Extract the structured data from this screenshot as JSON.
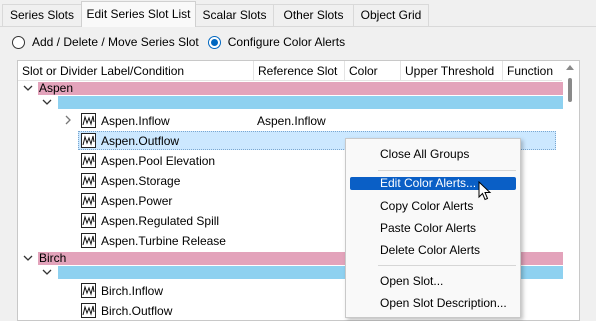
{
  "tabs": [
    {
      "label": "Series Slots"
    },
    {
      "label": "Edit Series Slot List"
    },
    {
      "label": "Scalar Slots"
    },
    {
      "label": "Other Slots"
    },
    {
      "label": "Object Grid"
    }
  ],
  "active_tab": "Edit Series Slot List",
  "modes": [
    {
      "label": "Add / Delete / Move Series Slot",
      "selected": false
    },
    {
      "label": "Configure Color Alerts",
      "selected": true
    }
  ],
  "grid": {
    "columns": [
      "Slot or Divider Label/Condition",
      "Reference Slot",
      "Color",
      "Upper Threshold",
      "Function"
    ],
    "groups": [
      {
        "label": "Aspen",
        "color_group": "#e3a3bb",
        "color_sub": "#8ed1f0",
        "slots": [
          {
            "label": "Aspen.Inflow",
            "reference": "Aspen.Inflow",
            "expandable": true
          },
          {
            "label": "Aspen.Outflow",
            "reference": "",
            "selected": true
          },
          {
            "label": "Aspen.Pool Elevation",
            "reference": ""
          },
          {
            "label": "Aspen.Storage",
            "reference": ""
          },
          {
            "label": "Aspen.Power",
            "reference": ""
          },
          {
            "label": "Aspen.Regulated Spill",
            "reference": ""
          },
          {
            "label": "Aspen.Turbine Release",
            "reference": ""
          }
        ]
      },
      {
        "label": "Birch",
        "color_group": "#e3a3bb",
        "color_sub": "#8ed1f0",
        "slots": [
          {
            "label": "Birch.Inflow",
            "reference": ""
          },
          {
            "label": "Birch.Outflow",
            "reference": ""
          }
        ]
      }
    ]
  },
  "context_menu": {
    "items": [
      {
        "label": "Close All Groups"
      },
      {
        "label": "Edit Color Alerts...",
        "highlighted": true
      },
      {
        "label": "Copy Color Alerts"
      },
      {
        "label": "Paste Color Alerts"
      },
      {
        "label": "Delete Color Alerts"
      },
      {
        "label": "Open Slot..."
      },
      {
        "label": "Open Slot Description..."
      }
    ]
  },
  "colors": {
    "accent": "#0a5fc6",
    "selection": "#cce8ff",
    "group_band": "#e3a3bb",
    "subgroup_band": "#8ed1f0"
  }
}
